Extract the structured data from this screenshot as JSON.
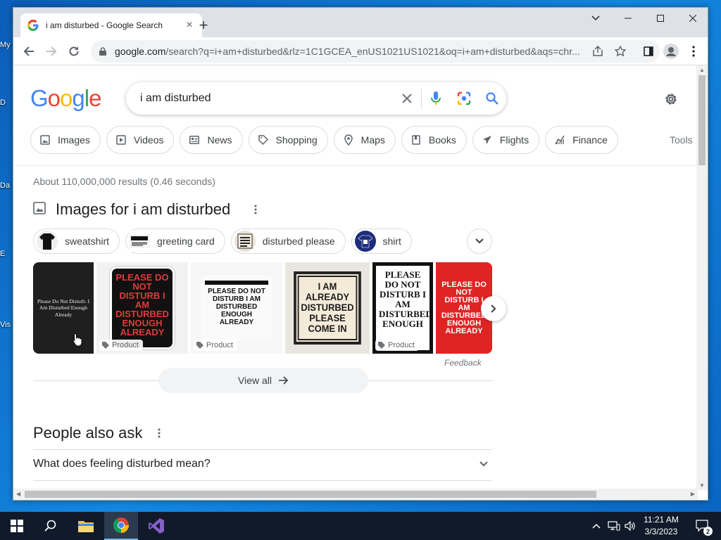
{
  "desktop": {
    "icon_labels": [
      "My",
      "D",
      "Da",
      "E",
      "Vis"
    ]
  },
  "browser": {
    "tab_title": "i am disturbed - Google Search",
    "url_host": "google.com",
    "url_rest": "/search?q=i+am+disturbed&rlz=1C1GCEA_enUS1021US1021&oq=i+am+disturbed&aqs=chr..."
  },
  "google": {
    "logo": [
      "G",
      "o",
      "o",
      "g",
      "l",
      "e"
    ],
    "logo_colors": [
      "#4285f4",
      "#ea4335",
      "#fbbc05",
      "#4285f4",
      "#34a853",
      "#ea4335"
    ],
    "query": "i am disturbed",
    "chips": [
      {
        "label": "Images",
        "icon": "image-icon"
      },
      {
        "label": "Videos",
        "icon": "play-icon"
      },
      {
        "label": "News",
        "icon": "news-icon"
      },
      {
        "label": "Shopping",
        "icon": "tag-icon"
      },
      {
        "label": "Maps",
        "icon": "map-pin-icon"
      },
      {
        "label": "Books",
        "icon": "book-icon"
      },
      {
        "label": "Flights",
        "icon": "plane-icon"
      },
      {
        "label": "Finance",
        "icon": "finance-icon"
      }
    ],
    "tools": "Tools",
    "stats": "About 110,000,000 results (0.46 seconds)",
    "images_title": "Images for i am disturbed",
    "related": [
      "sweatshirt",
      "greeting card",
      "disturbed please",
      "shirt"
    ],
    "images": [
      {
        "text": "Please Do Not Disturb. I Am Disturbed Enough Already",
        "product": false
      },
      {
        "text": "PLEASE DO NOT DISTURB I AM DISTURBED ENOUGH ALREADY",
        "product": true
      },
      {
        "text": "PLEASE DO NOT DISTURB I AM DISTURBED ENOUGH ALREADY",
        "product": true
      },
      {
        "text": "I AM ALREADY DISTURBED PLEASE COME IN",
        "product": false
      },
      {
        "text": "PLEASE DO NOT DISTURB I AM DISTURBED ENOUGH",
        "product": true
      },
      {
        "text": "PLEASE DO NOT DISTURB I AM DISTURBED ENOUGH ALREADY",
        "product": false
      }
    ],
    "product_label": "Product",
    "feedback": "Feedback",
    "view_all": "View all",
    "paa_title": "People also ask",
    "paa_q1": "What does feeling disturbed mean?"
  },
  "taskbar": {
    "time": "11:21 AM",
    "date": "3/3/2023",
    "notifications": "2"
  }
}
